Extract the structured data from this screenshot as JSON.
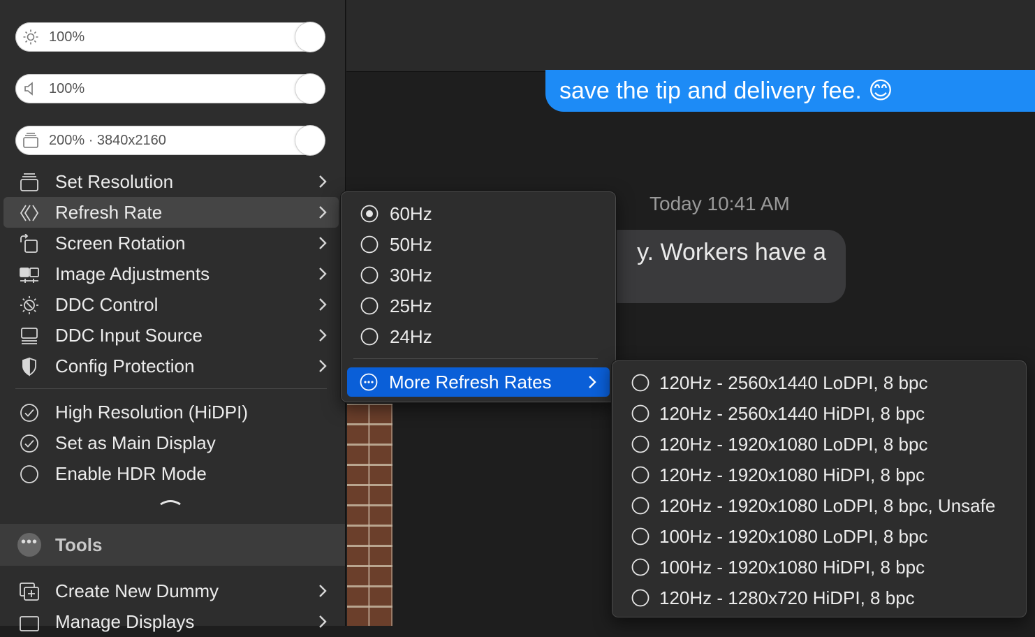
{
  "sliders": {
    "brightness": {
      "value": "100%",
      "icon": "sun-icon",
      "level": 1.0
    },
    "volume": {
      "value": "100%",
      "icon": "speaker-icon",
      "level": 1.0
    },
    "resolution": {
      "value": "200% · 3840x2160",
      "icon": "display-stack-icon",
      "level": 1.0
    }
  },
  "menu": {
    "items": [
      {
        "label": "Set Resolution",
        "icon": "display-stack-icon"
      },
      {
        "label": "Refresh Rate",
        "icon": "refresh-rate-icon"
      },
      {
        "label": "Screen Rotation",
        "icon": "rotate-icon"
      },
      {
        "label": "Image Adjustments",
        "icon": "image-adjust-icon"
      },
      {
        "label": "DDC Control",
        "icon": "ddc-sun-icon"
      },
      {
        "label": "DDC Input Source",
        "icon": "input-source-icon"
      },
      {
        "label": "Config Protection",
        "icon": "shield-icon"
      }
    ],
    "toggles": [
      {
        "label": "High Resolution (HiDPI)",
        "checked": true
      },
      {
        "label": "Set as Main Display",
        "checked": true
      },
      {
        "label": "Enable HDR Mode",
        "checked": false
      }
    ],
    "tools_label": "Tools",
    "tools_items": [
      {
        "label": "Create New Dummy",
        "icon": "add-display-icon"
      },
      {
        "label": "Manage Displays",
        "icon": "display-icon"
      }
    ]
  },
  "refresh_submenu": {
    "options": [
      {
        "label": "60Hz",
        "selected": true
      },
      {
        "label": "50Hz",
        "selected": false
      },
      {
        "label": "30Hz",
        "selected": false
      },
      {
        "label": "25Hz",
        "selected": false
      },
      {
        "label": "24Hz",
        "selected": false
      }
    ],
    "more_label": "More Refresh Rates"
  },
  "more_submenu": {
    "options": [
      "120Hz - 2560x1440 LoDPI, 8 bpc",
      "120Hz - 2560x1440 HiDPI, 8 bpc",
      "120Hz - 1920x1080 LoDPI, 8 bpc",
      "120Hz - 1920x1080 HiDPI, 8 bpc",
      "120Hz - 1920x1080 LoDPI, 8 bpc, Unsafe",
      "100Hz - 1920x1080 LoDPI, 8 bpc",
      "100Hz - 1920x1080 HiDPI, 8 bpc",
      "120Hz - 1280x720 HiDPI, 8 bpc"
    ]
  },
  "background": {
    "message_blue": "save the tip and delivery fee. 😊",
    "timestamp": "Today 10:41 AM",
    "message_gray": "y.   Workers have a"
  },
  "colors": {
    "accent": "#0a5fd8",
    "bubble_blue": "#1d8bf6",
    "menu_bg": "#2d2d2d"
  }
}
